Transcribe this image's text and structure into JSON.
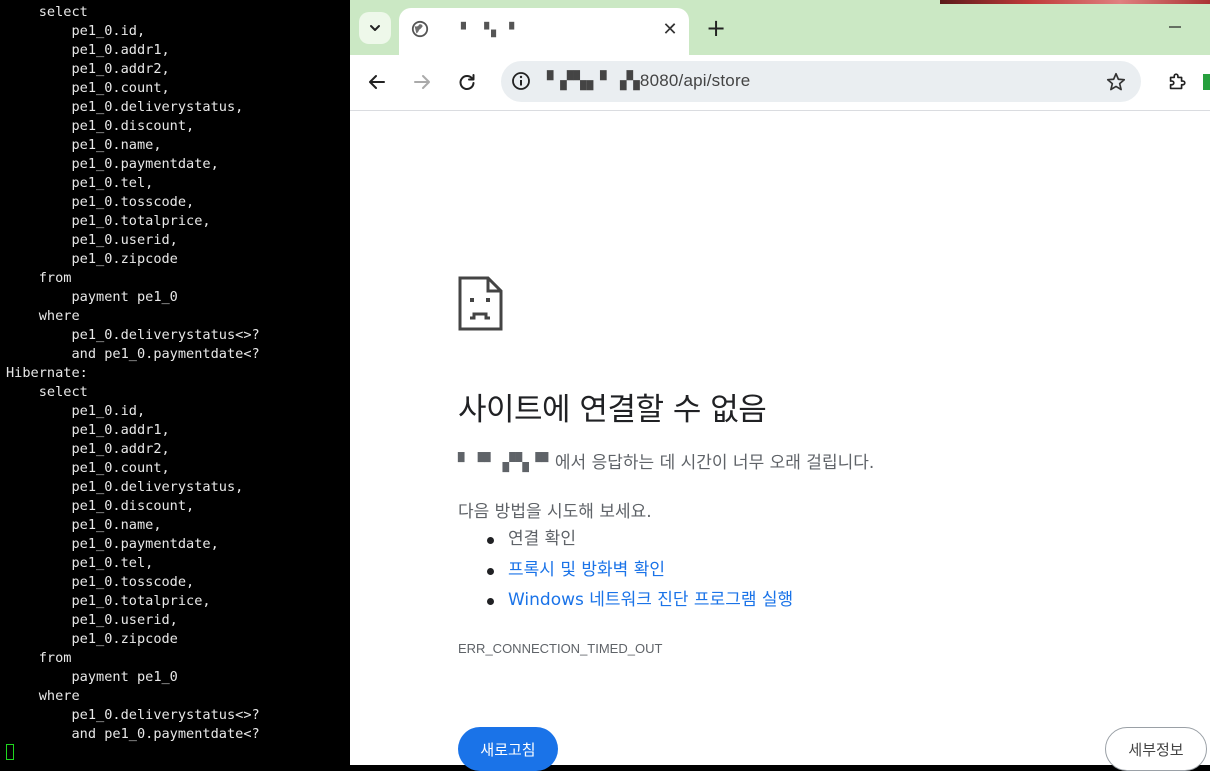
{
  "terminal": {
    "lines": [
      "    select",
      "        pe1_0.id,",
      "        pe1_0.addr1,",
      "        pe1_0.addr2,",
      "        pe1_0.count,",
      "        pe1_0.deliverystatus,",
      "        pe1_0.discount,",
      "        pe1_0.name,",
      "        pe1_0.paymentdate,",
      "        pe1_0.tel,",
      "        pe1_0.tosscode,",
      "        pe1_0.totalprice,",
      "        pe1_0.userid,",
      "        pe1_0.zipcode",
      "    from",
      "        payment pe1_0",
      "    where",
      "        pe1_0.deliverystatus<>?",
      "        and pe1_0.paymentdate<?",
      "Hibernate:",
      "    select",
      "        pe1_0.id,",
      "        pe1_0.addr1,",
      "        pe1_0.addr2,",
      "        pe1_0.count,",
      "        pe1_0.deliverystatus,",
      "        pe1_0.discount,",
      "        pe1_0.name,",
      "        pe1_0.paymentdate,",
      "        pe1_0.tel,",
      "        pe1_0.tosscode,",
      "        pe1_0.totalprice,",
      "        pe1_0.userid,",
      "        pe1_0.zipcode",
      "    from",
      "        payment pe1_0",
      "    where",
      "        pe1_0.deliverystatus<>?",
      "        and pe1_0.paymentdate<?"
    ]
  },
  "browser": {
    "tab": {
      "title": "▘ ▝▖ ▘",
      "favicon": "globe-icon"
    },
    "address_bar": {
      "url": "▘▞▚▖▘▗▚8080/api/store"
    },
    "error": {
      "title": "사이트에 연결할 수 없음",
      "description": "▘▝▘ ▞▚▝▘에서 응답하는 데 시간이 너무 오래 걸립니다.",
      "try_heading": "다음 방법을 시도해 보세요.",
      "suggestions": [
        {
          "text": "연결 확인",
          "link": false
        },
        {
          "text": "프록시 및 방화벽 확인",
          "link": true
        },
        {
          "text": "Windows 네트워크 진단 프로그램 실행",
          "link": true
        }
      ],
      "code": "ERR_CONNECTION_TIMED_OUT",
      "reload_label": "새로고침",
      "details_label": "세부정보"
    }
  },
  "colors": {
    "tabstrip": "#cbe8c4",
    "accent_blue": "#1a73e8",
    "terminal_cursor": "#1fd61f"
  }
}
